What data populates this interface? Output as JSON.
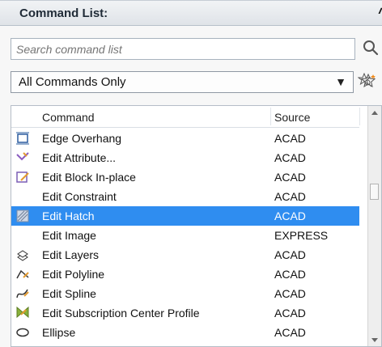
{
  "panel": {
    "title": "Command List:"
  },
  "search": {
    "placeholder": "Search command list"
  },
  "filter": {
    "selected": "All Commands Only"
  },
  "table": {
    "headers": {
      "command": "Command",
      "source": "Source"
    },
    "rows": [
      {
        "command": "Edge Overhang",
        "source": "ACAD",
        "icon": "edge-overhang-icon"
      },
      {
        "command": "Edit Attribute...",
        "source": "ACAD",
        "icon": "edit-attribute-icon"
      },
      {
        "command": "Edit Block In-place",
        "source": "ACAD",
        "icon": "edit-block-icon"
      },
      {
        "command": "Edit Constraint",
        "source": "ACAD",
        "icon": ""
      },
      {
        "command": "Edit Hatch",
        "source": "ACAD",
        "icon": "edit-hatch-icon",
        "selected": true
      },
      {
        "command": "Edit Image",
        "source": "EXPRESS",
        "icon": ""
      },
      {
        "command": "Edit Layers",
        "source": "ACAD",
        "icon": "edit-layers-icon"
      },
      {
        "command": "Edit Polyline",
        "source": "ACAD",
        "icon": "edit-polyline-icon"
      },
      {
        "command": "Edit Spline",
        "source": "ACAD",
        "icon": "edit-spline-icon"
      },
      {
        "command": "Edit Subscription Center Profile",
        "source": "ACAD",
        "icon": "subscription-center-icon"
      },
      {
        "command": "Ellipse",
        "source": "ACAD",
        "icon": "ellipse-icon"
      }
    ]
  },
  "icons": {
    "collapse": "double-chevron-up-icon",
    "search": "magnifier-icon",
    "star_search": "star-search-icon",
    "star_add": "star-add-icon"
  },
  "colors": {
    "selection": "#2f8df0",
    "header_bg": "#e6eaee",
    "text": "#111111"
  }
}
